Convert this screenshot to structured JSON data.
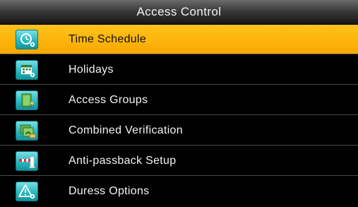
{
  "window": {
    "title": "Access Control"
  },
  "menu": {
    "selected_index": 0,
    "items": [
      {
        "label": "Time Schedule",
        "icon": "clock-gear-icon"
      },
      {
        "label": "Holidays",
        "icon": "calendar-gear-icon"
      },
      {
        "label": "Access Groups",
        "icon": "door-person-icon"
      },
      {
        "label": "Combined Verification",
        "icon": "fingerprint-card-icon"
      },
      {
        "label": "Anti-passback Setup",
        "icon": "barrier-gate-icon"
      },
      {
        "label": "Duress Options",
        "icon": "warning-gear-icon"
      }
    ]
  },
  "colors": {
    "selected_background": "#f9a800",
    "icon_tile": "#2cb8c0",
    "background": "#000000"
  }
}
